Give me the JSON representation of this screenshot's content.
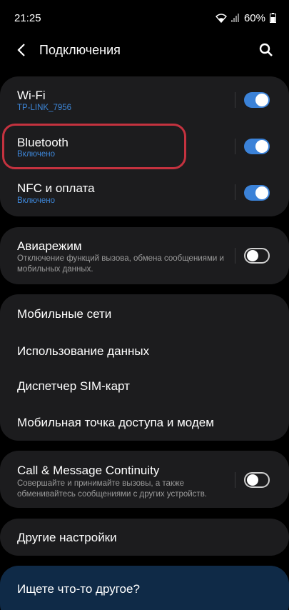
{
  "status_bar": {
    "time": "21:25",
    "battery": "60%"
  },
  "header": {
    "title": "Подключения",
    "back_icon": "back-arrow-icon",
    "search_icon": "search-icon"
  },
  "connections": {
    "wifi": {
      "label": "Wi-Fi",
      "sub": "TP-LINK_7956",
      "on": true
    },
    "bluetooth": {
      "label": "Bluetooth",
      "sub": "Включено",
      "on": true
    },
    "nfc": {
      "label": "NFC и оплата",
      "sub": "Включено",
      "on": true
    }
  },
  "airplane": {
    "label": "Авиарежим",
    "desc": "Отключение функций вызова, обмена сообщениями и мобильных данных.",
    "on": false
  },
  "network_items": [
    {
      "label": "Мобильные сети"
    },
    {
      "label": "Использование данных"
    },
    {
      "label": "Диспетчер SIM-карт"
    },
    {
      "label": "Мобильная точка доступа и модем"
    }
  ],
  "continuity": {
    "label": "Call & Message Continuity",
    "desc": "Совершайте и принимайте вызовы, а также обменивайтесь сообщениями с других устройств.",
    "on": false
  },
  "other": {
    "label": "Другие настройки"
  },
  "footer": {
    "label": "Ищете что-то другое?"
  },
  "colors": {
    "accent": "#3b82d8",
    "card": "#1c1c1e",
    "highlight": "#c4323f",
    "footer_bg": "#0f2a47"
  }
}
